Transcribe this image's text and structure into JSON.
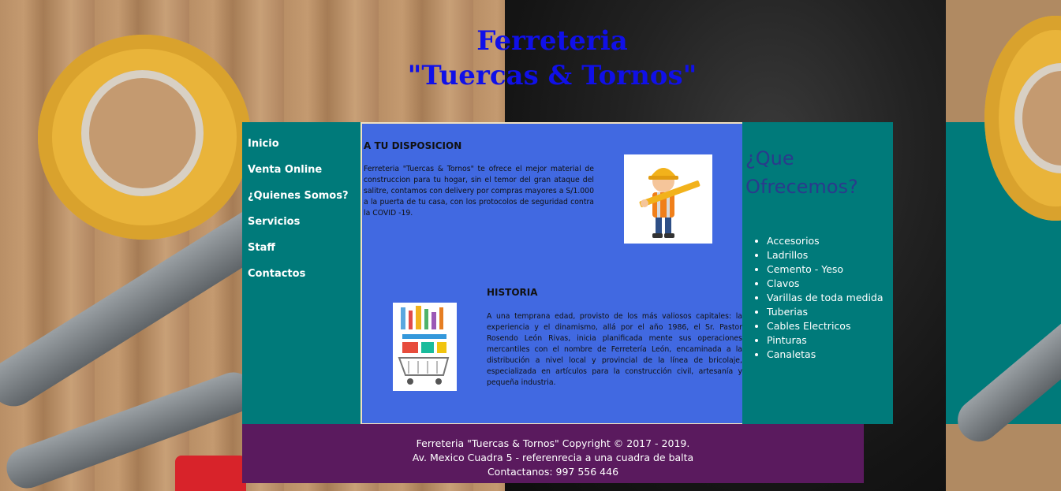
{
  "header": {
    "title_line1": "Ferreteria",
    "title_line2": "\"Tuercas & Tornos\""
  },
  "nav": {
    "items": [
      {
        "label": "Inicio"
      },
      {
        "label": "Venta Online"
      },
      {
        "label": "¿Quienes Somos?"
      },
      {
        "label": "Servicios"
      },
      {
        "label": "Staff"
      },
      {
        "label": "Contactos"
      }
    ]
  },
  "main": {
    "section1": {
      "title": "A TU DISPOSICION",
      "text": "Ferreteria \"Tuercas & Tornos\" te ofrece el mejor material de construccion para tu hogar, sin el temor del gran ataque del salitre, contamos con delivery por compras mayores a S/1.000 a la puerta de tu casa, con los protocolos de seguridad contra la COVID -19."
    },
    "section2": {
      "title": "HISTORIA",
      "text": "A una temprana edad, provisto de los más valiosos capitales: la experiencia y el dinamismo, allá por el año 1986, el Sr. Pastor Rosendo León Rivas, inicia planificada mente sus operaciones mercantiles con el nombre de Ferretería León, encaminada a la distribución a nivel local y provincial de la línea de bricolaje, especializada en artículos para la construcción civil, artesanía y pequeña industria."
    }
  },
  "aside": {
    "heading": "¿Que Ofrecemos?",
    "items": [
      "Accesorios",
      "Ladrillos",
      "Cemento - Yeso",
      "Clavos",
      "Varillas de toda medida",
      "Tuberias",
      "Cables Electricos",
      "Pinturas",
      "Canaletas"
    ]
  },
  "footer": {
    "line1": "Ferreteria \"Tuercas & Tornos\" Copyright © 2017 - 2019.",
    "line2": "Av. Mexico Cuadra 5 - referenrecia a una cuadra de balta",
    "line3": "Contactanos: 997 556 446"
  },
  "colors": {
    "title": "#1010e8",
    "sidebar": "#007a7a",
    "main": "#4169e1",
    "footer": "#5a1a5e",
    "aside_heading": "#2a3a8c"
  }
}
